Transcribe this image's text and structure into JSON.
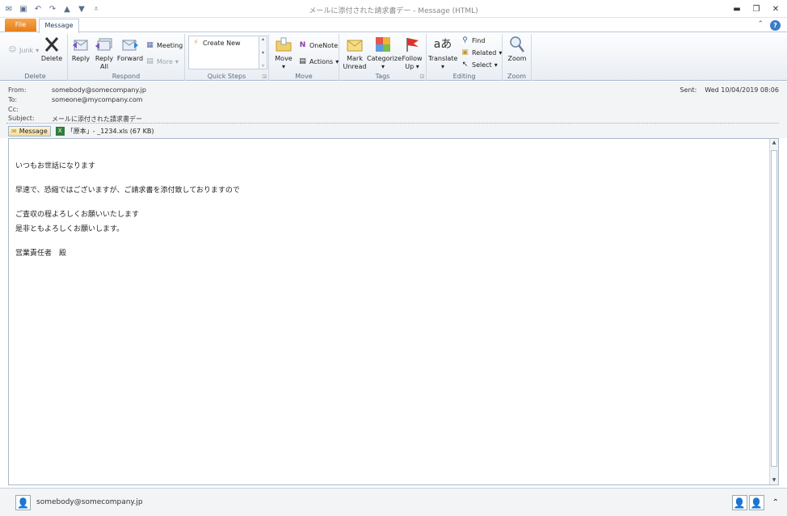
{
  "window": {
    "title": "メールに添付された請求書デー - Message (HTML)",
    "qat_icons": [
      "email-icon",
      "save-icon",
      "undo-icon",
      "redo-icon",
      "up-arrow-icon",
      "down-arrow-icon",
      "customize-qat-icon"
    ],
    "controls": [
      "minimize",
      "restore",
      "close"
    ]
  },
  "tabs": {
    "file": "File",
    "message": "Message"
  },
  "ribbon": {
    "groups": {
      "delete": "Delete",
      "respond": "Respond",
      "quick_steps": "Quick Steps",
      "move": "Move",
      "tags": "Tags",
      "editing": "Editing",
      "zoom": "Zoom"
    },
    "junk": "Junk",
    "delete": "Delete",
    "reply": "Reply",
    "reply_all_1": "Reply",
    "reply_all_2": "All",
    "forward": "Forward",
    "meeting": "Meeting",
    "more": "More",
    "create_new": "Create New",
    "move": "Move",
    "onenote": "OneNote",
    "actions": "Actions",
    "mark_unread_1": "Mark",
    "mark_unread_2": "Unread",
    "categorize": "Categorize",
    "follow_up_1": "Follow",
    "follow_up_2": "Up",
    "translate": "Translate",
    "find": "Find",
    "related": "Related",
    "select": "Select",
    "zoom": "Zoom"
  },
  "header": {
    "from_label": "From:",
    "from": "somebody@somecompany.jp",
    "to_label": "To:",
    "to": "someone@mycompany.com",
    "cc_label": "Cc:",
    "cc": "",
    "subject_label": "Subject:",
    "subject": "メールに添付された請求書デー",
    "sent_label": "Sent:",
    "sent": "Wed 10/04/2019 08:06",
    "message_tab": "Message",
    "attachment": "「原本」- _1234.xls (67 KB)"
  },
  "body": {
    "lines": [
      "いつもお世話になります",
      "早速で、恐縮ではございますが、ご請求書を添付致しておりますので",
      "ご査収の程よろしくお願いいたします",
      "是非ともよろしくお願いします。",
      "営業責任者　殿"
    ]
  },
  "footer": {
    "sender": "somebody@somecompany.jp"
  },
  "colors": {
    "file_tab": "#e67e1c",
    "ribbon_bg": "#e9eef4",
    "accent": "#3b7bc8"
  }
}
